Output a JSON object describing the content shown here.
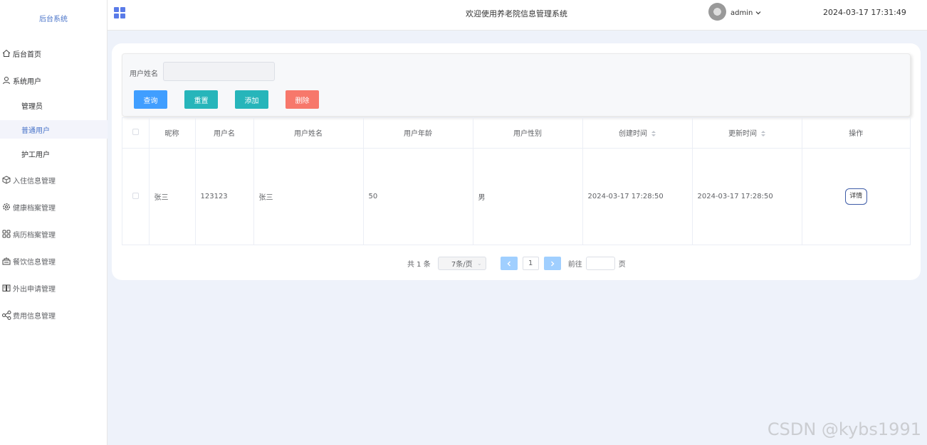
{
  "sidebar": {
    "brand": "后台系统",
    "items": [
      {
        "label": "后台首页",
        "icon": "home-icon"
      },
      {
        "label": "系统用户",
        "icon": "user-icon"
      },
      {
        "label": "管理员",
        "icon": ""
      },
      {
        "label": "普通用户",
        "icon": ""
      },
      {
        "label": "护工用户",
        "icon": ""
      },
      {
        "label": "入住信息管理",
        "icon": "box-icon"
      },
      {
        "label": "健康档案管理",
        "icon": "gear-icon"
      },
      {
        "label": "病历档案管理",
        "icon": "grid-icon"
      },
      {
        "label": "餐饮信息管理",
        "icon": "tray-icon"
      },
      {
        "label": "外出申请管理",
        "icon": "book-icon"
      },
      {
        "label": "费用信息管理",
        "icon": "share-icon"
      }
    ]
  },
  "topbar": {
    "title": "欢迎使用养老院信息管理系统",
    "user": "admin",
    "datetime": "2024-03-17 17:31:49"
  },
  "search": {
    "label": "用户姓名",
    "placeholder": "",
    "value": "",
    "buttons": {
      "query": "查询",
      "reset": "重置",
      "add": "添加",
      "delete": "删除"
    }
  },
  "table": {
    "columns": [
      "昵称",
      "用户名",
      "用户姓名",
      "用户年龄",
      "用户性别",
      "创建时间",
      "更新时间",
      "操作"
    ],
    "rows": [
      {
        "nickname": "张三",
        "username": "123123",
        "name": "张三",
        "age": "50",
        "gender": "男",
        "created": "2024-03-17 17:28:50",
        "updated": "2024-03-17 17:28:50",
        "action": "详情"
      }
    ]
  },
  "pagination": {
    "total": "共 1 条",
    "page_size": "7条/页",
    "current_page": "1",
    "goto_label": "前往",
    "page_suffix": "页"
  },
  "watermark": "CSDN @kybs1991",
  "colors": {
    "primary": "#409eff",
    "teal": "#27b5ba",
    "danger": "#f7786b",
    "active_menu": "#4a74c9"
  }
}
